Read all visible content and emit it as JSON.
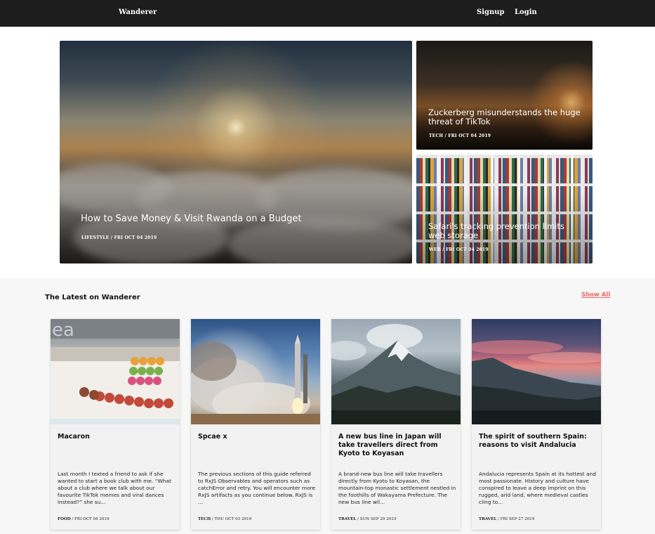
{
  "nav": {
    "brand": "Wanderer",
    "signup": "Signup",
    "login": "Login"
  },
  "hero": {
    "main": {
      "title": "How to Save Money & Visit Rwanda on a Budget",
      "category": "LIFESTYLE",
      "date": "FRI OCT 04 2019"
    },
    "top_right": {
      "title": "Zuckerberg misunderstands the huge threat of TikTok",
      "category": "TECH",
      "date": "FRI OCT 04 2019"
    },
    "bottom_right": {
      "title": "Safari's tracking prevention limits web storage",
      "category": "WEB",
      "date": "FRI OCT 04 2019"
    }
  },
  "latest": {
    "title": "The Latest on Wanderer",
    "show_all": "Show All",
    "cards": [
      {
        "title": "Macaron",
        "excerpt": "Last month I texted a friend to ask if she wanted to start a book club with me. “What about a club where we talk about our favourite TikTok memes and viral dances instead?” she su...",
        "category": "FOOD",
        "date": "FRI OCT 04 2019"
      },
      {
        "title": "Spcae x",
        "excerpt": "The previous sections of this guide referred to RxJS Observables and operators such as catchError and retry. You will encounter more RxJS artifacts as you continue below. RxJS is ...",
        "category": "TECH",
        "date": "THU OCT 03 2019"
      },
      {
        "title": "A new bus line in Japan will take travellers direct from Kyoto to Koyasan",
        "excerpt": "A brand-new bus line will take travellers directly from Kyoto to Koyasan, the mountain-top monastic settlement nestled in the foothills of Wakayama Prefecture. The new bus line wil...",
        "category": "TRAVEL",
        "date": "SUN SEP 29 2019"
      },
      {
        "title": "The spirit of southern Spain: reasons to visit Andalucia",
        "excerpt": "Andalucia represents Spain at its hottest and most passionate. History and culture have conspired to leave a deep imprint on this rugged, arid land, where medieval castles cling to...",
        "category": "TRAVEL",
        "date": "FRI SEP 27 2019"
      }
    ]
  }
}
